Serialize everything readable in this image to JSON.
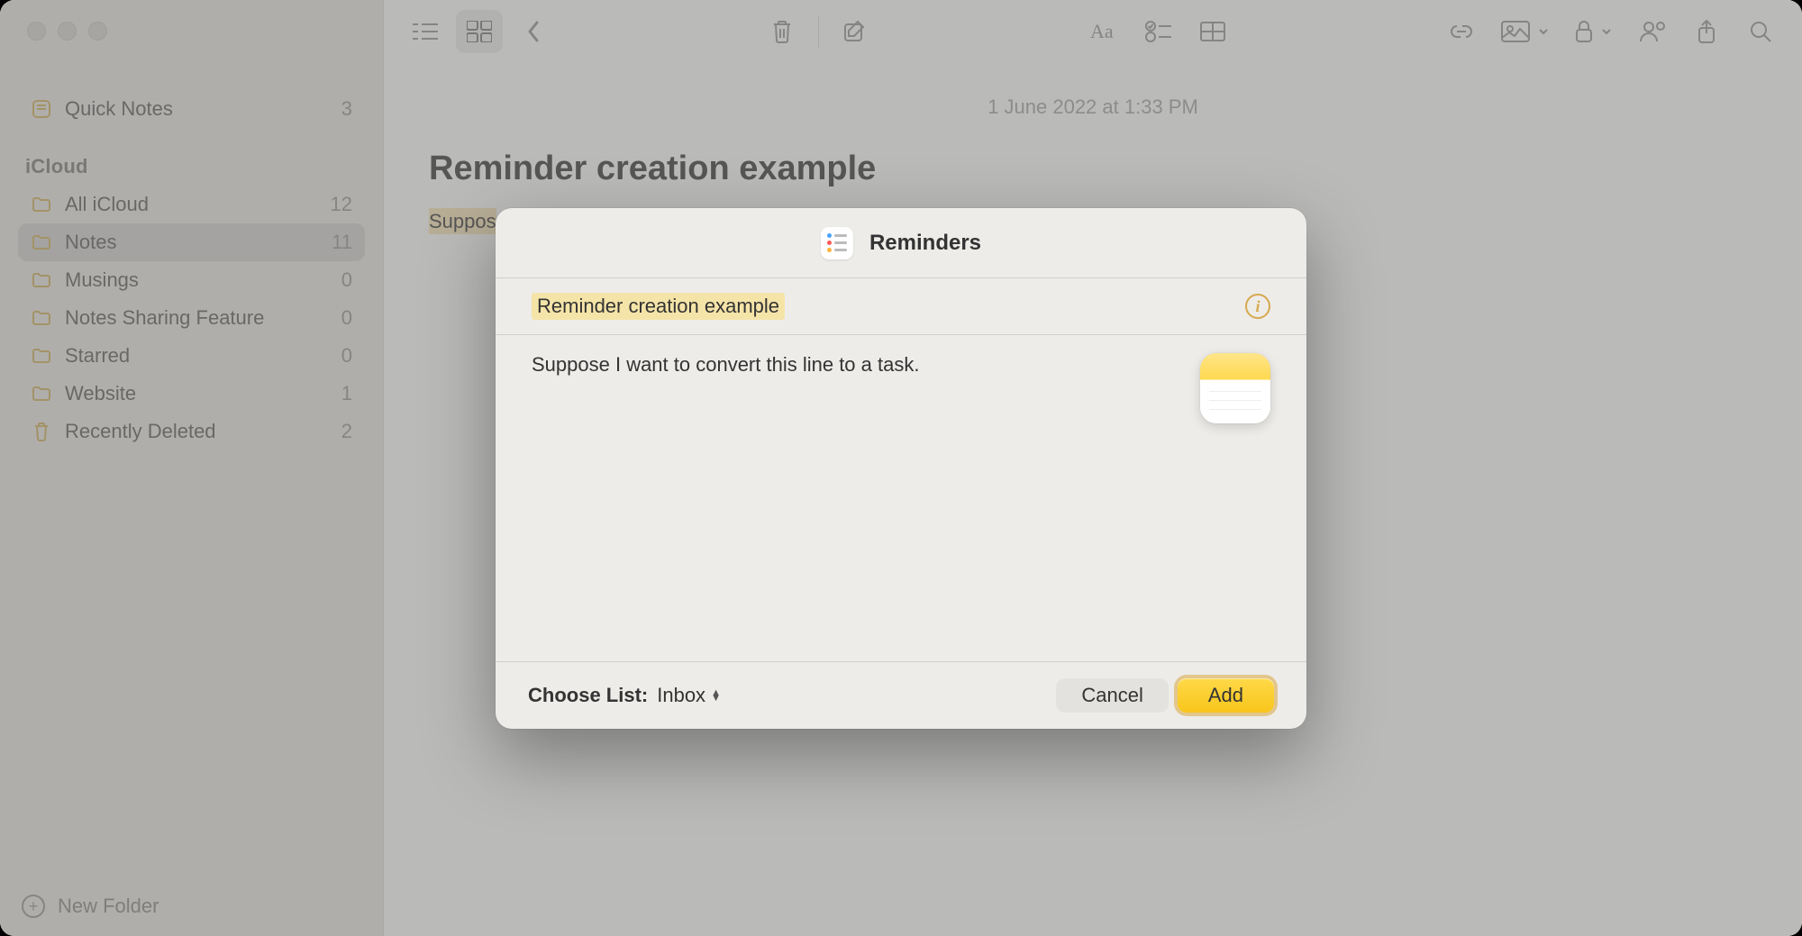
{
  "sidebar": {
    "quick_notes": {
      "label": "Quick Notes",
      "count": "3"
    },
    "section_label": "iCloud",
    "folders": [
      {
        "label": "All iCloud",
        "count": "12"
      },
      {
        "label": "Notes",
        "count": "11"
      },
      {
        "label": "Musings",
        "count": "0"
      },
      {
        "label": "Notes Sharing Feature",
        "count": "0"
      },
      {
        "label": "Starred",
        "count": "0"
      },
      {
        "label": "Website",
        "count": "1"
      },
      {
        "label": "Recently Deleted",
        "count": "2"
      }
    ],
    "new_folder_label": "New Folder"
  },
  "note": {
    "date": "1 June 2022 at 1:33 PM",
    "title": "Reminder creation example",
    "body_highlighted_fragment": "Suppos"
  },
  "sheet": {
    "app_title": "Reminders",
    "reminder_title": "Reminder creation example",
    "body_text": "Suppose I want to convert this line to a task.",
    "choose_list_label": "Choose List:",
    "choose_list_value": "Inbox",
    "cancel_label": "Cancel",
    "add_label": "Add"
  }
}
